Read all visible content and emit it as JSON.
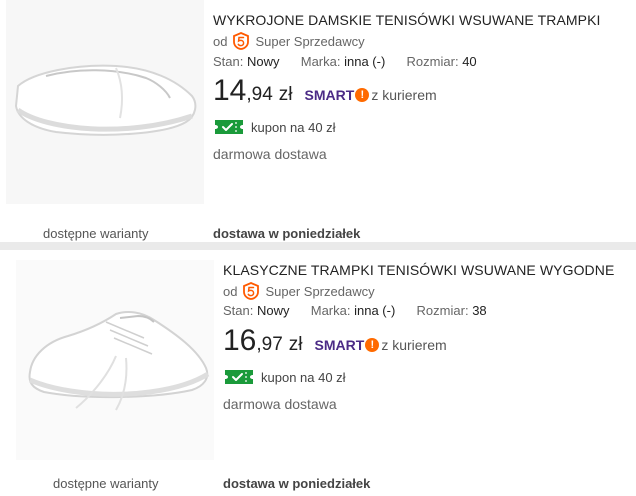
{
  "listings": [
    {
      "title": "WYKROJONE DAMSKIE TENISÓWKI WSUWANE TRAMPKI",
      "seller_prefix": "od",
      "seller_name": "Super Sprzedawcy",
      "condition_label": "Stan:",
      "condition_value": "Nowy",
      "brand_label": "Marka:",
      "brand_value": "inna (-)",
      "size_label": "Rozmiar:",
      "size_value": "40",
      "price_int": "14",
      "price_frac": ",94",
      "currency": "zł",
      "smart_label": "SMART",
      "smart_bang": "!",
      "smart_courier": "z kurierem",
      "coupon_text": "kupon na 40 zł",
      "delivery_text": "darmowa dostawa",
      "delivery_date": "dostawa w poniedziałek",
      "variants_text": "dostępne warianty"
    },
    {
      "title": "KLASYCZNE TRAMPKI TENISÓWKI WSUWANE WYGODNE",
      "seller_prefix": "od",
      "seller_name": "Super Sprzedawcy",
      "condition_label": "Stan:",
      "condition_value": "Nowy",
      "brand_label": "Marka:",
      "brand_value": "inna (-)",
      "size_label": "Rozmiar:",
      "size_value": "38",
      "price_int": "16",
      "price_frac": ",97",
      "currency": "zł",
      "smart_label": "SMART",
      "smart_bang": "!",
      "smart_courier": "z kurierem",
      "coupon_text": "kupon na 40 zł",
      "delivery_text": "darmowa dostawa",
      "delivery_date": "dostawa w poniedziałek",
      "variants_text": "dostępne warianty"
    }
  ],
  "colors": {
    "smart": "#4b2a86",
    "smart_accent": "#ff6a00",
    "coupon_green": "#1a9a3a",
    "super_seller": "#ff5a00"
  }
}
